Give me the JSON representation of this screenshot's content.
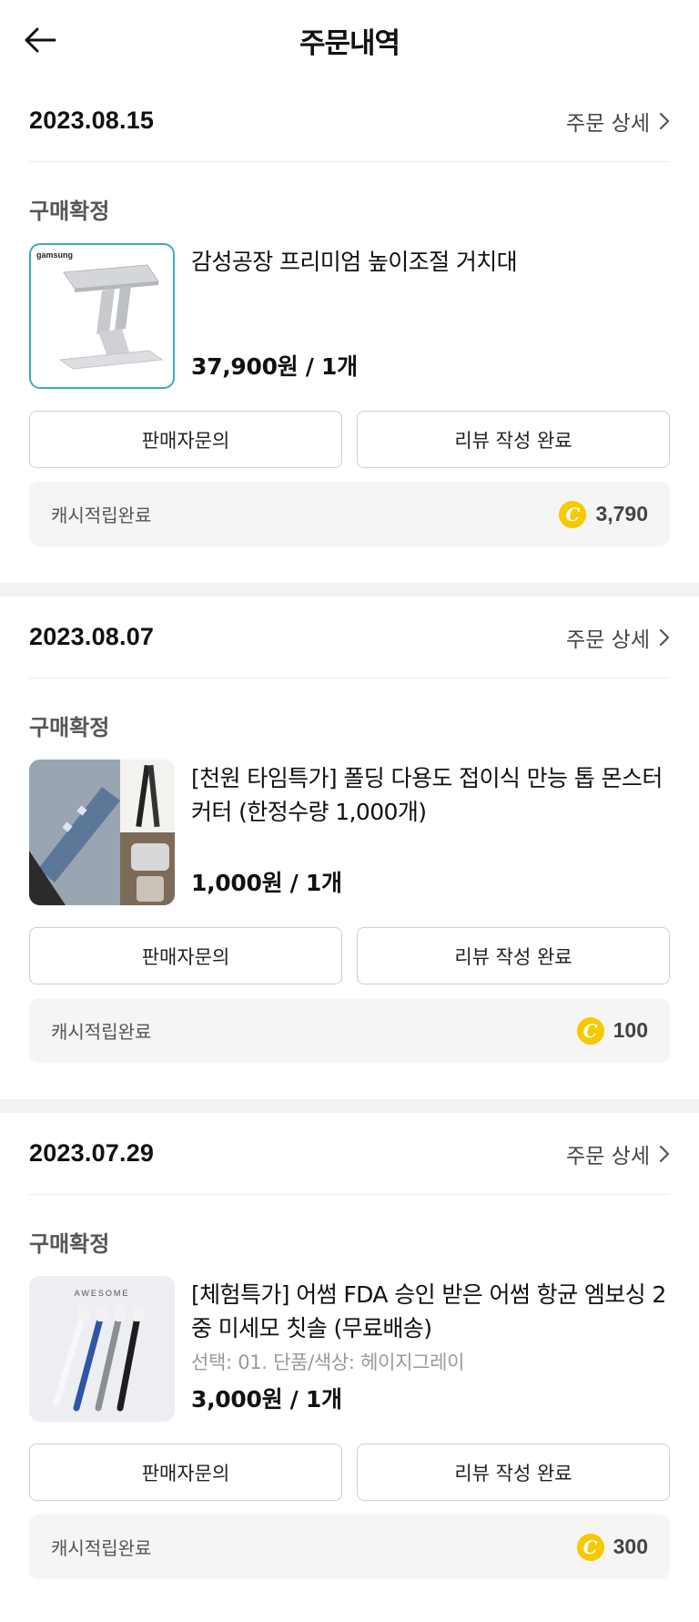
{
  "header": {
    "title": "주문내역"
  },
  "orders": [
    {
      "date": "2023.08.15",
      "detail_label": "주문 상세",
      "status": "구매확정",
      "product": {
        "name": "감성공장 프리미엄 높이조절 거치대",
        "option": "",
        "price": "37,900원 / 1개",
        "brand_text": "gamsung",
        "thumb_icon": "laptop-stand-image"
      },
      "buttons": {
        "inquiry": "판매자문의",
        "review": "리뷰 작성 완료"
      },
      "cash": {
        "label": "캐시적립완료",
        "amount": "3,790",
        "coin_symbol": "C"
      }
    },
    {
      "date": "2023.08.07",
      "detail_label": "주문 상세",
      "status": "구매확정",
      "product": {
        "name": "[천원 타임특가] 폴딩 다용도 접이식 만능 톱 몬스터 커터 (한정수량 1,000개)",
        "option": "",
        "price": "1,000원 / 1개",
        "thumb_icon": "folding-cutter-image"
      },
      "buttons": {
        "inquiry": "판매자문의",
        "review": "리뷰 작성 완료"
      },
      "cash": {
        "label": "캐시적립완료",
        "amount": "100",
        "coin_symbol": "C"
      }
    },
    {
      "date": "2023.07.29",
      "detail_label": "주문 상세",
      "status": "구매확정",
      "product": {
        "name": "[체험특가] 어썸 FDA 승인 받은 어썸 항균 엠보싱 2중 미세모 칫솔 (무료배송)",
        "option": "선택: 01. 단품/색상: 헤이지그레이",
        "price": "3,000원 / 1개",
        "brand_text": "AWESOME",
        "thumb_icon": "toothbrush-image"
      },
      "buttons": {
        "inquiry": "판매자문의",
        "review": "리뷰 작성 완료"
      },
      "cash": {
        "label": "캐시적립완료",
        "amount": "300",
        "coin_symbol": "C"
      }
    }
  ],
  "colors": {
    "coin": "#f7c900",
    "text": "#111111",
    "muted": "#9a9a9a",
    "separator": "#f2f2f2"
  }
}
